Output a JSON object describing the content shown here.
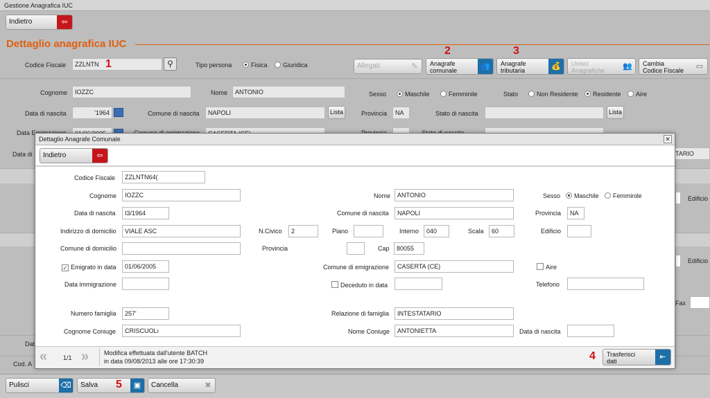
{
  "app": {
    "title": "Gestione Anagrafica IUC"
  },
  "toolbar": {
    "back_label": "Indietro"
  },
  "section": {
    "title": "Dettaglio anagrafica IUC"
  },
  "main": {
    "codice_fiscale_label": "Codice Fiscale",
    "codice_fiscale_value": "ZZLNTN",
    "tipo_persona_label": "Tipo persona",
    "tipo_persona_options": [
      "Fisica",
      "Giuridica"
    ],
    "allegati_label": "Allegati",
    "anagrafe_comunale_label": "Anagrafe\ncomunale",
    "anagrafe_tributaria_label": "Anagrafe\ntributaria",
    "unisci_label": "Unisci\nAnagrafiche",
    "cambia_cf_label": "Cambia\nCodice Fiscale",
    "cognome_label": "Cognome",
    "cognome_value": "IOZZC",
    "nome_label": "Nome",
    "nome_value": "ANTONIO",
    "sesso_label": "Sesso",
    "sesso_options": [
      "Maschile",
      "Femminile"
    ],
    "stato_label": "Stato",
    "stato_options": [
      "Non Residente",
      "Residente",
      "Aire"
    ],
    "data_nascita_label": "Data di nascita",
    "data_nascita_value": "'1964",
    "comune_nascita_label": "Comune di nascita",
    "comune_nascita_value": "NAPOLI",
    "lista_label": "Lista",
    "provincia_label": "Provincia",
    "provincia_value": "NA",
    "stato_nascita_label": "Stato di nascita",
    "data_emigrazione_label": "Data Emigrazione",
    "data_emigrazione_value": "01/06/2005",
    "comune_emigrazione_label": "Comune di emigrazione",
    "comune_emigrazione_value": "CASERTA (CE)",
    "data_di_label": "Data di",
    "tario_value": "TARIO",
    "edificio_label": "Edificio",
    "fax_label": "Fax",
    "dat_label": "Dat",
    "cod_label": "Cod. A"
  },
  "markers": {
    "m1": "1",
    "m2": "2",
    "m3": "3",
    "m4": "4",
    "m5": "5"
  },
  "footer": {
    "pulisci_label": "Pulisci",
    "salva_label": "Salva",
    "cancella_label": "Cancella"
  },
  "dialog": {
    "title": "Dettaglio Anagrafe Comunale",
    "back_label": "Indietro",
    "codice_fiscale_label": "Codice Fiscale",
    "codice_fiscale_value": "ZZLNTN64(",
    "cognome_label": "Cognome",
    "cognome_value": "IOZZC",
    "nome_label": "Nome",
    "nome_value": "ANTONIO",
    "sesso_label": "Sesso",
    "sesso_options": [
      "Maschile",
      "Femminile"
    ],
    "data_nascita_label": "Data di nascita",
    "data_nascita_value": "I3/1964",
    "comune_nascita_label": "Comune di nascita",
    "comune_nascita_value": "NAPOLI",
    "provincia_label": "Provincia",
    "provincia_value": "NA",
    "indirizzo_label": "Indirizzo di domicilio",
    "indirizzo_value": "VIALE ASC",
    "civico_label": "N.Civico",
    "civico_value": "2",
    "piano_label": "Piano",
    "interno_label": "Interno",
    "interno_value": "040",
    "scala_label": "Scala",
    "scala_value": "60",
    "edificio_label": "Edificio",
    "comune_domicilio_label": "Comune di domicilio",
    "provincia2_label": "Provincia",
    "cap_label": "Cap",
    "cap_value": "80055",
    "emigrato_label": "Emigrato in data",
    "emigrato_value": "01/06/2005",
    "comune_emigrazione_label": "Comune di emigrazione",
    "comune_emigrazione_value": "CASERTA (CE)",
    "aire_label": "Aire",
    "data_immigrazione_label": "Data immigrazione",
    "deceduto_label": "Deceduto in data",
    "telefono_label": "Telefono",
    "numero_famiglia_label": "Numero famiglia",
    "numero_famiglia_value": "257'",
    "relazione_label": "Relazione di famiglia",
    "relazione_value": "INTESTATARIO",
    "cognome_coniuge_label": "Cognome Coniuge",
    "cognome_coniuge_value": "CRISCUOLı",
    "nome_coniuge_label": "Nome Coniuge",
    "nome_coniuge_value": "ANTONIETTA",
    "data_nascita2_label": "Data di nascita",
    "page_indicator": "1/1",
    "modifica_line1": "Modifica effettuata dall'utente BATCH",
    "modifica_line2": "in data 09/08/2013 alle ore 17:30:39",
    "trasferisci_label": "Trasferisci\ndati"
  },
  "colors": {
    "accent": "#e06010",
    "red": "#c4161c",
    "blue": "#1d6fa8"
  }
}
